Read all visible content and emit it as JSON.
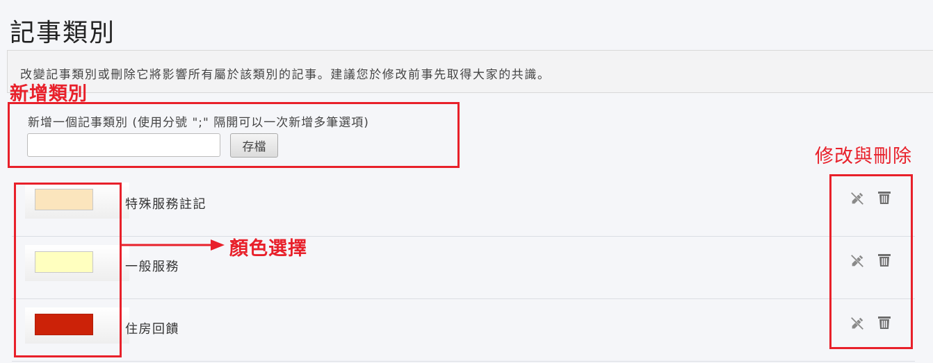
{
  "page": {
    "title": "記事類別",
    "notice": "改變記事類別或刪除它將影響所有屬於該類別的記事。建議您於修改前事先取得大家的共識。"
  },
  "annotations": {
    "add": "新增類別",
    "color": "顏色選擇",
    "edit_delete": "修改與刪除",
    "color_accent": "#e8202a"
  },
  "add_form": {
    "label": "新增一個記事類別  (使用分號 \";\" 隔開可以一次新增多筆選項)",
    "input_value": "",
    "save_label": "存檔"
  },
  "categories": [
    {
      "name": "特殊服務註記",
      "color": "#fbe5bd"
    },
    {
      "name": "一般服務",
      "color": "#ffffbf"
    },
    {
      "name": "住房回饋",
      "color": "#cc2208"
    }
  ],
  "icons": {
    "edit": "edit-off-icon",
    "delete": "trash-icon"
  }
}
